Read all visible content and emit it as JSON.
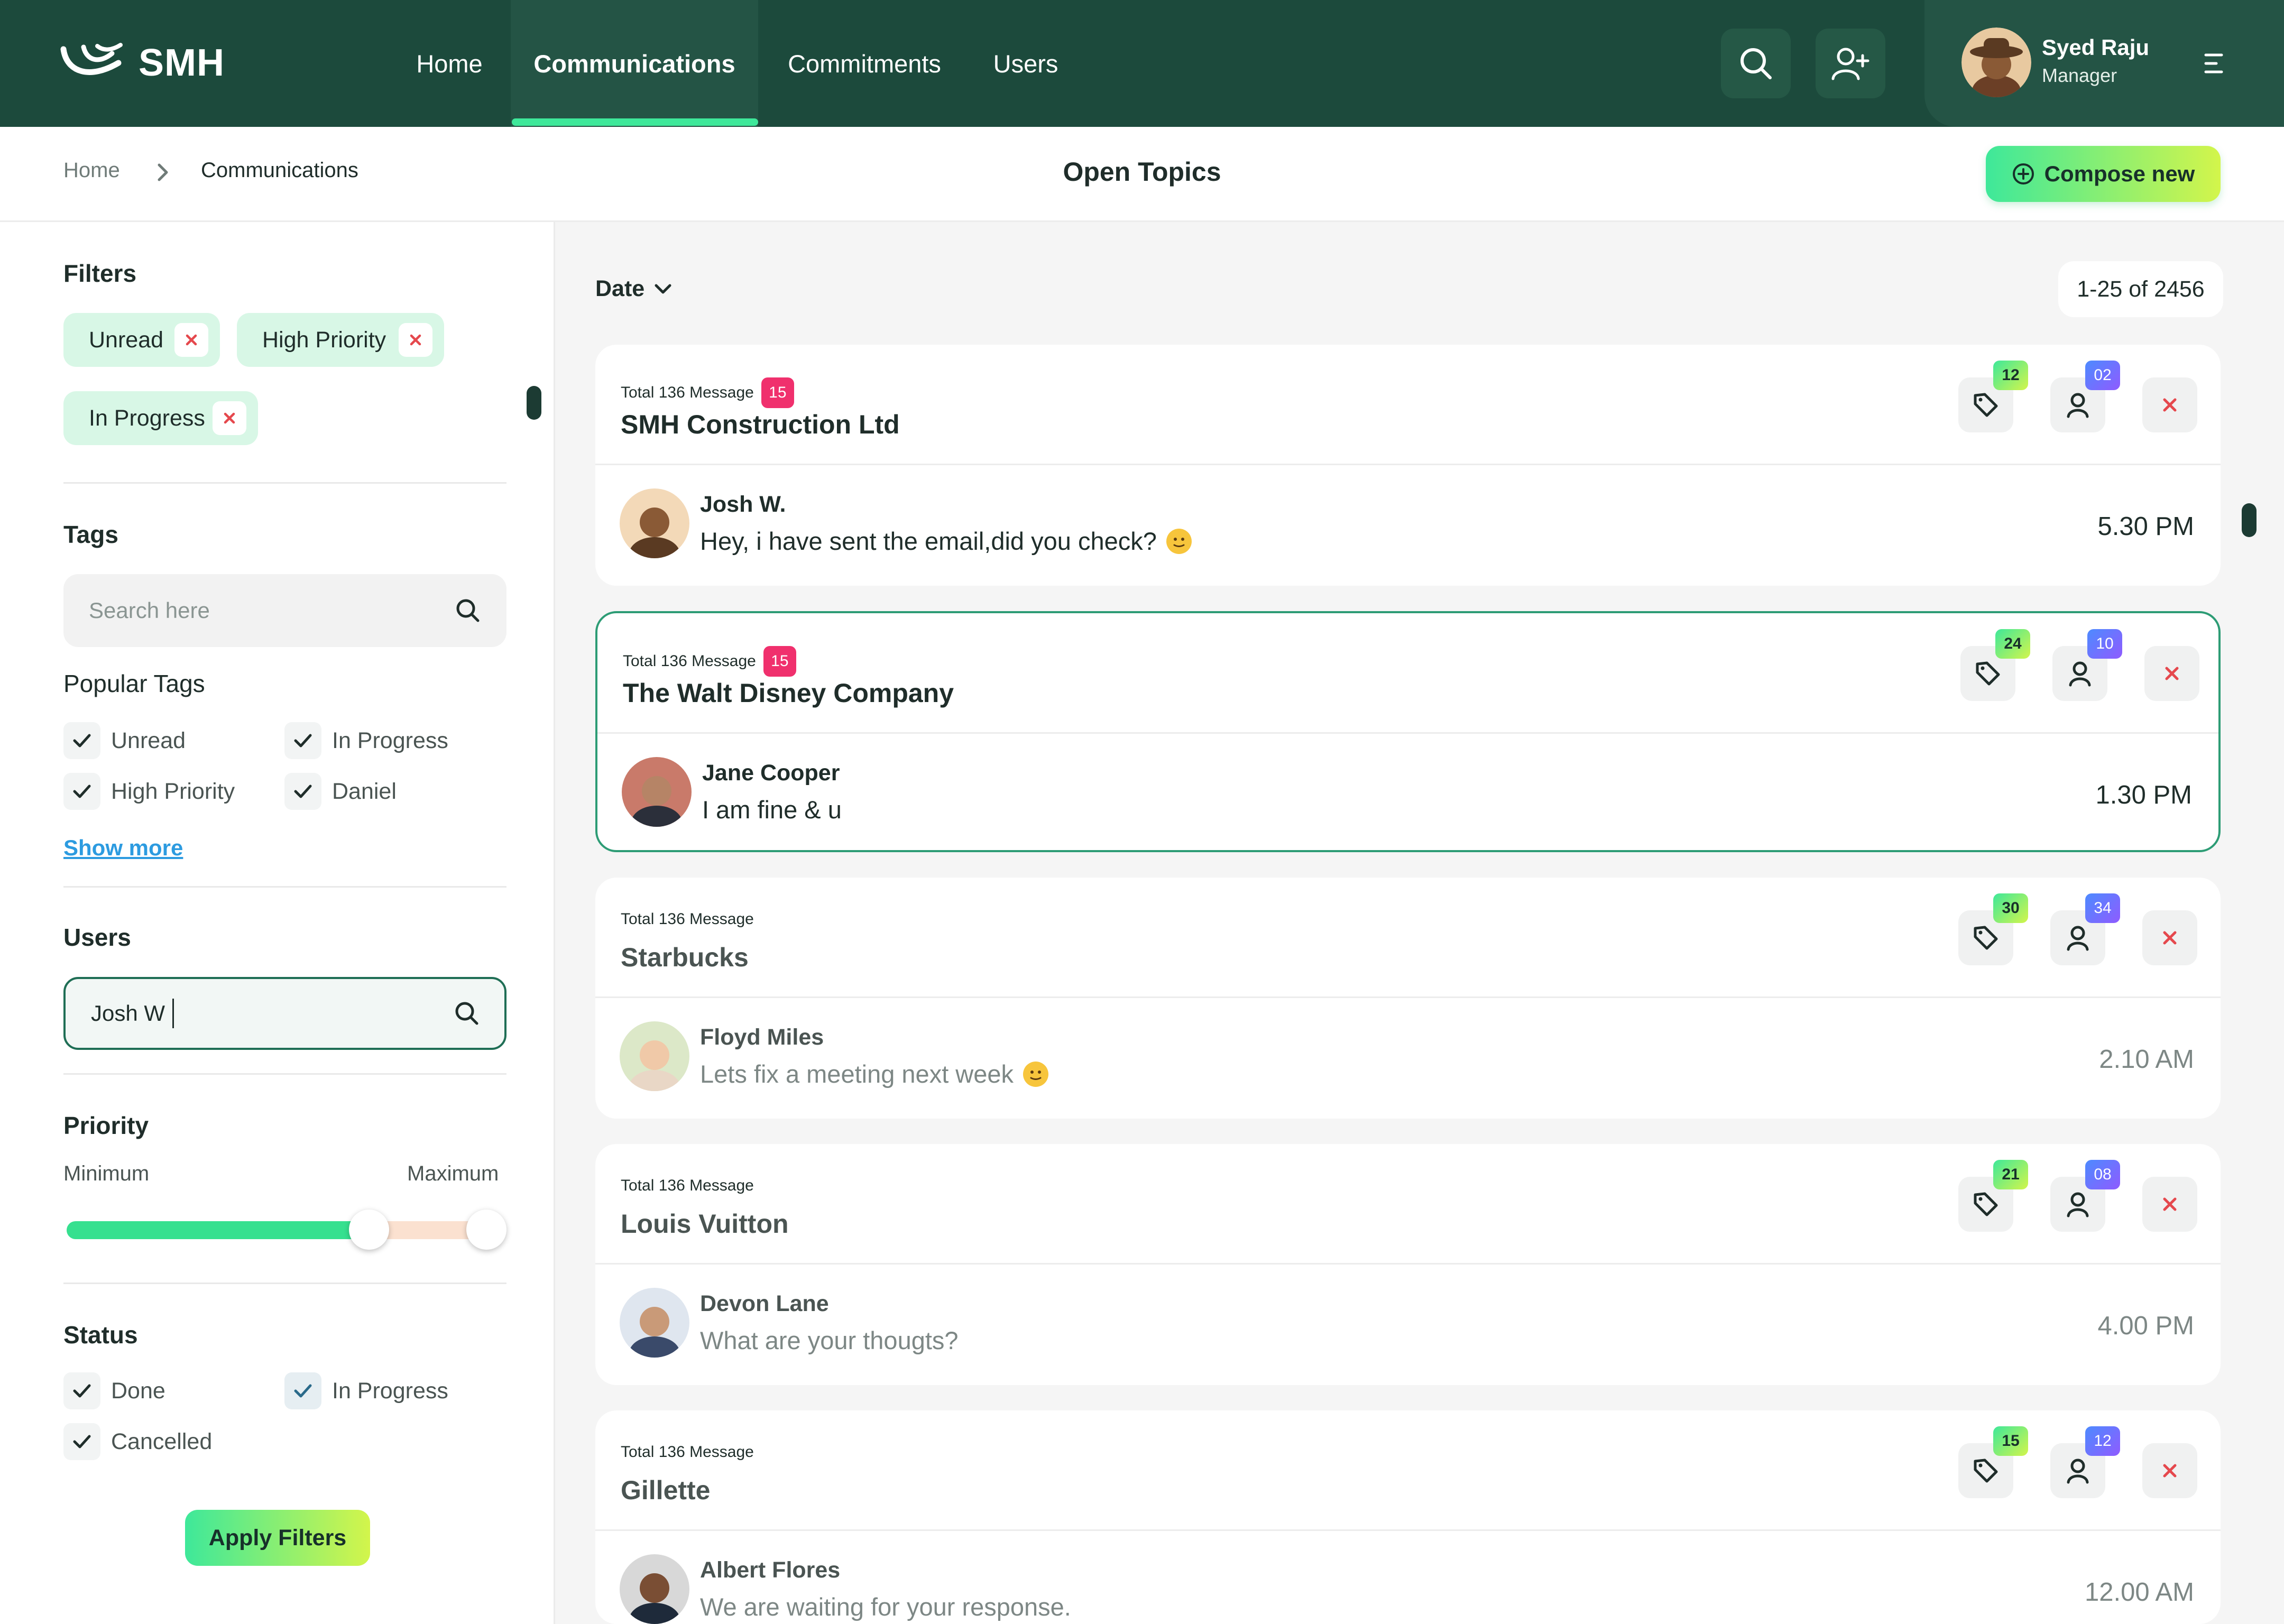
{
  "app": {
    "brand": "SMH"
  },
  "nav": {
    "items": [
      {
        "label": "Home"
      },
      {
        "label": "Communications"
      },
      {
        "label": "Commitments"
      },
      {
        "label": "Users"
      }
    ]
  },
  "profile": {
    "name": "Syed Raju",
    "role": "Manager"
  },
  "breadcrumb": {
    "home": "Home",
    "current": "Communications"
  },
  "page": {
    "title": "Open Topics",
    "compose_label": "Compose new"
  },
  "filters": {
    "title": "Filters",
    "chips": [
      "Unread",
      "High Priority",
      "In Progress"
    ]
  },
  "tags": {
    "title": "Tags",
    "search_placeholder": "Search here",
    "popular_title": "Popular Tags",
    "popular": [
      "Unread",
      "In Progress",
      "High Priority",
      "Daniel"
    ],
    "show_more": "Show more"
  },
  "users": {
    "title": "Users",
    "search_value": "Josh W"
  },
  "priority": {
    "title": "Priority",
    "min_label": "Minimum",
    "max_label": "Maximum",
    "range": [
      0.0,
      0.72
    ]
  },
  "status": {
    "title": "Status",
    "options": [
      "Done",
      "In Progress",
      "Cancelled"
    ]
  },
  "apply_label": "Apply Filters",
  "list": {
    "sort_label": "Date",
    "count": "1-25 of 2456",
    "topics": [
      {
        "total": "Total 136 Message",
        "unread": "15",
        "company": "SMH Construction Ltd",
        "tags": "12",
        "users": "02",
        "sender": "Josh W.",
        "message": "Hey, i have sent the email,did you check?",
        "time": "5.30 PM",
        "emoji": true,
        "read": false
      },
      {
        "total": "Total 136 Message",
        "unread": "15",
        "company": "The Walt Disney Company",
        "tags": "24",
        "users": "10",
        "sender": "Jane Cooper",
        "message": "I am fine & u",
        "time": "1.30 PM",
        "emoji": false,
        "read": false
      },
      {
        "total": "Total 136 Message",
        "unread": "",
        "company": "Starbucks",
        "tags": "30",
        "users": "34",
        "sender": "Floyd Miles",
        "message": "Lets fix a meeting next week",
        "time": "2.10 AM",
        "emoji": true,
        "read": true
      },
      {
        "total": "Total 136 Message",
        "unread": "",
        "company": "Louis Vuitton",
        "tags": "21",
        "users": "08",
        "sender": "Devon Lane",
        "message": "What are your thougts?",
        "time": "4.00 PM",
        "emoji": false,
        "read": true
      },
      {
        "total": "Total 136 Message",
        "unread": "",
        "company": "Gillette",
        "tags": "15",
        "users": "12",
        "sender": "Albert Flores",
        "message": "We are waiting for your response.",
        "time": "12.00 AM",
        "emoji": false,
        "read": true
      }
    ]
  },
  "colors": {
    "nav_bg": "#1c4a3c",
    "accent_green": "#3ee89a",
    "accent_lime": "#d3f54b",
    "unread_badge": "#f0306d",
    "danger": "#e5484d"
  }
}
